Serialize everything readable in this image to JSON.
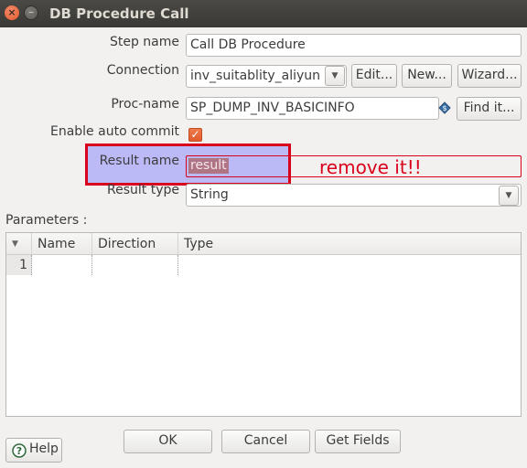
{
  "window": {
    "title": "DB Procedure Call",
    "close_glyph": "×",
    "minimize_glyph": "–"
  },
  "form": {
    "step_name_label": "Step name",
    "step_name_value": "Call DB Procedure",
    "connection_label": "Connection",
    "connection_value": "inv_suitablity_aliyun",
    "edit_button": "Edit...",
    "new_button": "New...",
    "wizard_button": "Wizard...",
    "proc_name_label": "Proc-name",
    "proc_name_value": "SP_DUMP_INV_BASICINFO",
    "find_button": "Find it...",
    "auto_commit_label": "Enable auto commit",
    "auto_commit_checked": true,
    "result_name_label": "Result name",
    "result_name_value": "result",
    "result_type_label": "Result type",
    "result_type_value": "String"
  },
  "annotation": {
    "text": "remove it!!",
    "color": "#d9001b"
  },
  "parameters": {
    "label": "Parameters :",
    "columns": [
      "Name",
      "Direction",
      "Type"
    ],
    "rows": [
      {
        "num": "1",
        "name": "",
        "direction": "",
        "type": ""
      }
    ]
  },
  "footer": {
    "help_button": "Help",
    "ok_button": "OK",
    "cancel_button": "Cancel",
    "get_fields_button": "Get Fields"
  },
  "icons": {
    "close": "close-icon",
    "minimize": "minimize-icon",
    "combo_arrow": "chevron-down-icon",
    "variable": "variable-diamond-icon",
    "help": "help-icon",
    "sort": "sort-triangle-icon"
  },
  "colors": {
    "accent_orange": "#e05b2c",
    "annotation_red": "#d9001b",
    "highlight_blue": "#7878ff"
  }
}
